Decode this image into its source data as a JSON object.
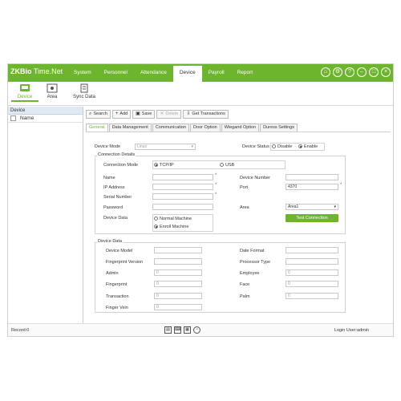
{
  "app": {
    "logo_part1": "ZKBio",
    "logo_part2": "Time.Net"
  },
  "menu": [
    "System",
    "Personnel",
    "Attendance",
    "Device",
    "Payroll",
    "Report"
  ],
  "menu_active": "Device",
  "subtools": {
    "device": "Device",
    "area": "Area",
    "sync": "Sync Data"
  },
  "left_panel": {
    "header": "Device",
    "column": "Name"
  },
  "actions": {
    "search": "Search",
    "add": "Add",
    "save": "Save",
    "delete": "Delete",
    "get_transactions": "Get Transactions"
  },
  "tabs": [
    "General",
    "Data Management",
    "Communication",
    "Door Option",
    "Wiegand Option",
    "Duress Settings"
  ],
  "form": {
    "device_mode_label": "Device Mode",
    "device_mode_value": "Linux",
    "device_status_label": "Device Status",
    "status_disable": "Disable",
    "status_enable": "Enable",
    "connection_details": "Connection Details",
    "connection_mode_label": "Connection Mode",
    "conn_tcpip": "TCP/IP",
    "conn_usb": "USB",
    "name_label": "Name",
    "ip_label": "IP Address",
    "serial_label": "Serial Number",
    "password_label": "Password",
    "device_data_label": "Device Data",
    "normal_machine": "Normal Machine",
    "enroll_machine": "Enroll Machine",
    "device_number_label": "Device Number",
    "port_label": "Port",
    "port_value": "4370",
    "area_label": "Area",
    "area_value": "Area1",
    "test_connection": "Test Connection"
  },
  "device_data": {
    "title": "Device Data",
    "device_model": "Device Model",
    "fingerprint_version": "Fingerprint Version",
    "admin": "Admin",
    "fingerprint": "Fingerprint",
    "transaction": "Transaction",
    "finger_vein": "Finger Vein",
    "date_format": "Date Format",
    "processor_type": "Processor Type",
    "employee": "Employee",
    "face": "Face",
    "palm": "Palm",
    "zero": "0"
  },
  "status": {
    "record": "Record:0",
    "login": "Login User:admin"
  },
  "colors": {
    "brand_green": "#6cb52d"
  }
}
